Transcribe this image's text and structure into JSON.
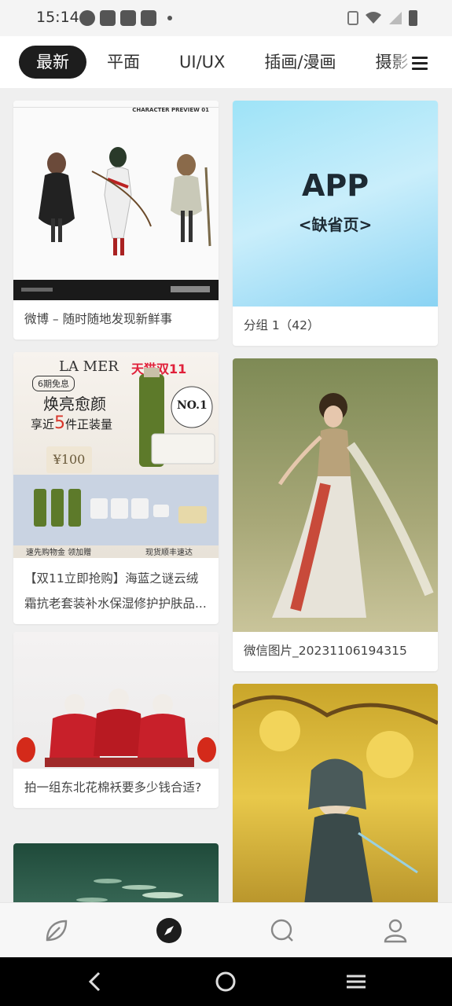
{
  "status_bar": {
    "time": "15:14",
    "left_icons": [
      "speedometer-icon",
      "mail-icon",
      "mail-icon",
      "mail-icon",
      "dot-icon"
    ],
    "right_icons": [
      "vibrate-icon",
      "wifi-icon",
      "signal-icon",
      "battery-icon"
    ]
  },
  "tabs": [
    {
      "label": "最新",
      "active": true
    },
    {
      "label": "平面",
      "active": false
    },
    {
      "label": "UI/UX",
      "active": false
    },
    {
      "label": "插画/漫画",
      "active": false
    },
    {
      "label": "摄影",
      "active": false
    }
  ],
  "menu_icon": "hamburger-icon",
  "feed": {
    "left_column": [
      {
        "caption": "微博 – 随时随地发现新鲜事",
        "image_title": "CHARACTER PREVIEW 01"
      },
      {
        "caption": "【双11立即抢购】海蓝之谜云绒霜抗老套装补水保湿修护护肤品...",
        "image_texts": {
          "brand": "LA MER",
          "tmall": "天猫双11",
          "periods": "6期免息",
          "headline": "焕亮愈颜",
          "sub_prefix": "享近",
          "sub_num": "5",
          "sub_suffix": "件正装量",
          "price": "¥100",
          "no1": "NO.1",
          "footer_left": "速先购物金 领加赠",
          "footer_right": "现货顺丰速达"
        }
      },
      {
        "caption": "拍一组东北花棉袄要多少钱合适?"
      },
      {
        "caption": ""
      }
    ],
    "right_column": [
      {
        "caption": "分组 1（42）",
        "image_texts": {
          "title": "APP",
          "subtitle": "<缺省页>"
        }
      },
      {
        "caption": "微信图片_20231106194315"
      },
      {
        "caption": ""
      }
    ]
  },
  "bottom_nav": [
    {
      "name": "home-leaf-icon",
      "active": false
    },
    {
      "name": "discover-compass-icon",
      "active": true
    },
    {
      "name": "search-icon",
      "active": false
    },
    {
      "name": "profile-icon",
      "active": false
    }
  ],
  "system_nav": [
    "back-icon",
    "home-icon",
    "recents-icon"
  ]
}
